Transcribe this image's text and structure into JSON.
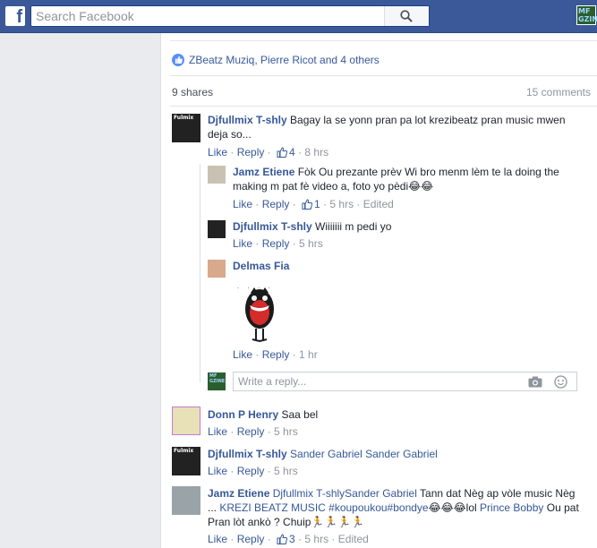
{
  "topbar": {
    "search_placeholder": "Search Facebook",
    "logo_letter": "f",
    "avatar_text": "MF\nGZINE",
    "brand_color": "#3b5998"
  },
  "post": {
    "likers": "ZBeatz Muziq, Pierre Ricot and 4 others",
    "shares": "9 shares",
    "comments": "15 comments"
  },
  "comments": [
    {
      "name": "Djfullmix T-shly",
      "text_line1": "Bagay la se yonn pran pa lot krezibeatz pran music mwen",
      "text_line2": "deja so...",
      "like": "Like",
      "reply": "Reply",
      "likes": "4",
      "time": "8 hrs",
      "avatar_tag": "Fulmix"
    },
    {
      "name": "Jamz Etiene",
      "text_line1": "Fòk Ou prezante prèv Wi bro menm lèm te la doing the",
      "text_line2": "making m pat fè video a, foto yo pèdi",
      "emoji": "😂😂",
      "like": "Like",
      "reply": "Reply",
      "likes": "1",
      "time": "5 hrs",
      "edited": "Edited"
    },
    {
      "name": "Djfullmix T-shly",
      "text": "Wiiiiiii m pedi yo",
      "like": "Like",
      "reply": "Reply",
      "time": "5 hrs"
    },
    {
      "name": "Delmas Fia",
      "like": "Like",
      "reply": "Reply",
      "time": "1 hr"
    },
    {
      "name": "Donn P Henry",
      "text": "Saa bel",
      "like": "Like",
      "reply": "Reply",
      "time": "5 hrs"
    },
    {
      "name": "Djfullmix T-shly",
      "mention": "Sander Gabriel Sander Gabriel",
      "like": "Like",
      "reply": "Reply",
      "time": "5 hrs"
    },
    {
      "name": "Jamz Etiene",
      "mention1": "Djfullmix T-shlySander Gabriel",
      "text1": "Tann dat Nèg ap vòle music Nèg",
      "text2_prefix": "...",
      "mention2": "KREZI BEATZ MUSIC #koupoukou",
      "text2_mid": "#bondye",
      "emoji2": "😂😂😂",
      "text2_lol": "lol",
      "mention3": "Prince Bobby",
      "text2_end": "Ou pat",
      "text3": "Pran lòt ankò ? Chuip",
      "emoji3": "🏃🏃🏃🏃",
      "like": "Like",
      "reply": "Reply",
      "likes": "3",
      "time": "5 hrs",
      "edited": "Edited"
    }
  ],
  "reply_box": {
    "placeholder": "Write a reply...",
    "avatar_text": "MF\nGZINE"
  }
}
